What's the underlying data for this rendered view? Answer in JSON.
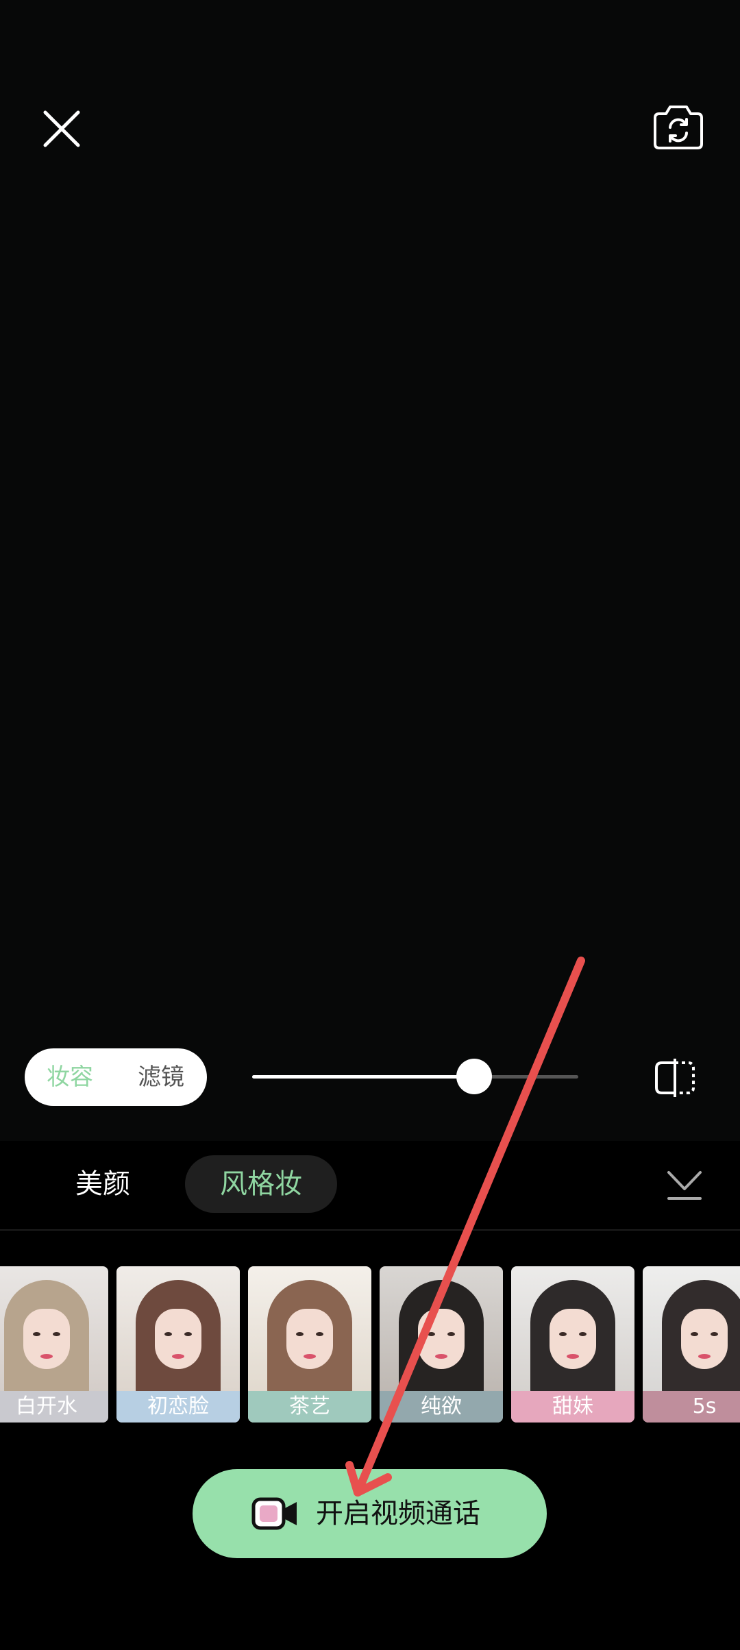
{
  "top_bar": {
    "close_icon": "close-icon",
    "flip_icon": "camera-flip-icon"
  },
  "adjust_bar": {
    "segments": [
      "妆容",
      "滤镜"
    ],
    "active_segment": "妆容",
    "intensity": 0.68,
    "compare_icon": "compare-icon"
  },
  "panel": {
    "tabs": [
      "美颜",
      "风格妆"
    ],
    "active_tab": "风格妆",
    "collapse_icon": "chevron-down-icon",
    "styles": [
      {
        "label": "白开水",
        "color": "#c9c9cf"
      },
      {
        "label": "初恋脸",
        "color": "#b7cfe3"
      },
      {
        "label": "茶艺",
        "color": "#9fc9bd"
      },
      {
        "label": "纯欲",
        "color": "#93a8ad"
      },
      {
        "label": "甜妹",
        "color": "#e6a7bd"
      },
      {
        "label": "5s",
        "color": "#bf8e9c"
      }
    ]
  },
  "call_button": {
    "label": "开启视频通话",
    "icon": "video-camera-icon"
  },
  "colors": {
    "accent_green": "#8fd6a1",
    "button_green": "#97e0ab",
    "annotation_red": "#e8504e"
  }
}
